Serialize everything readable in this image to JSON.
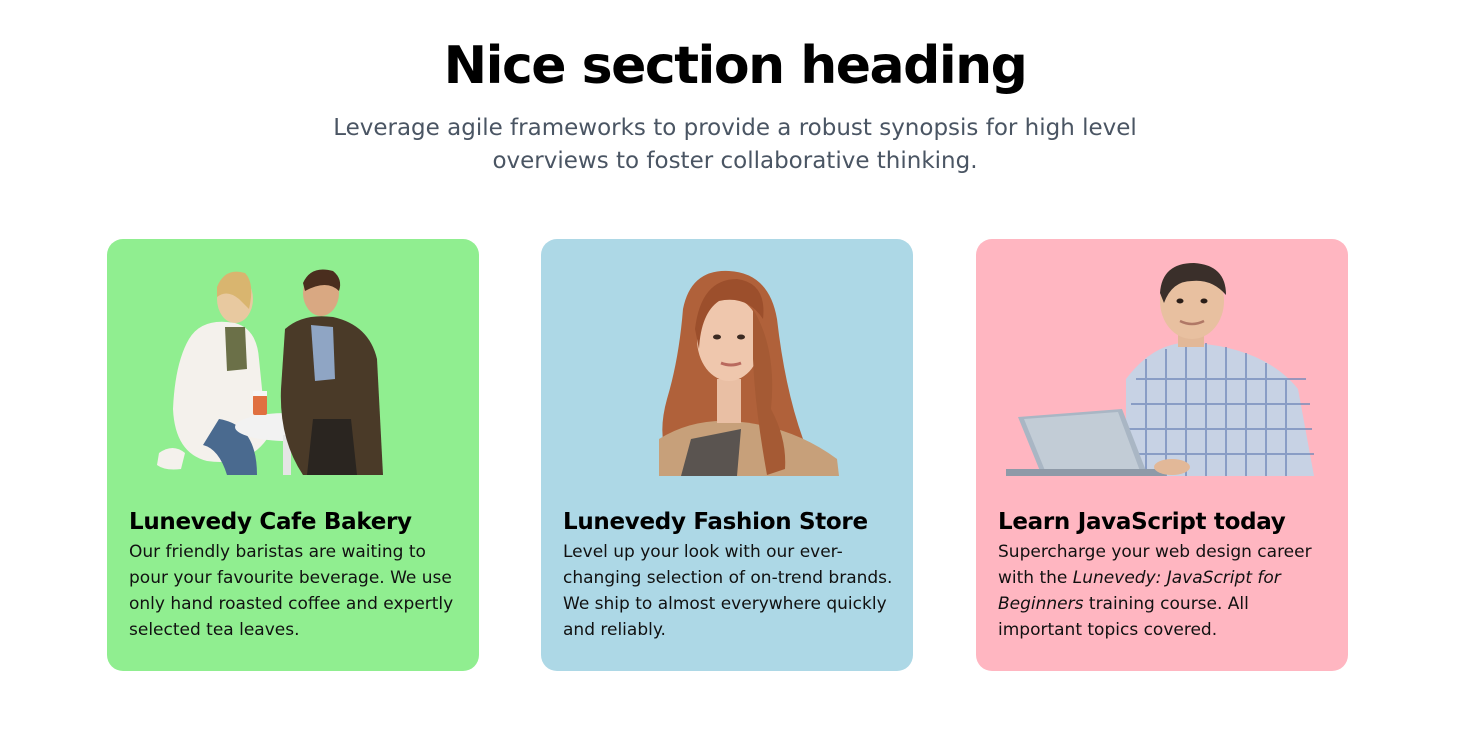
{
  "section": {
    "heading": "Nice section heading",
    "subheading": "Leverage agile frameworks to provide a robust synopsis for high level overviews to foster collaborative thinking."
  },
  "cards": [
    {
      "title": "Lunevedy Cafe Bakery",
      "text": "Our friendly baristas are waiting to pour your favourite beverage. We use only hand roasted coffee and expertly selected tea leaves.",
      "image": "couple-at-cafe-table-photo",
      "background": "#90ee90"
    },
    {
      "title": "Lunevedy Fashion Store",
      "text": "Level up your look with our ever-changing selection of on-trend brands. We ship to almost everywhere quickly and reliably.",
      "image": "woman-portrait-photo",
      "background": "#add8e6"
    },
    {
      "title": "Learn JavaScript today",
      "text_before": "Supercharge your web design career with the ",
      "text_emphasis": "Lunevedy: JavaScript for Beginners",
      "text_after": " training course. All important topics covered.",
      "image": "man-with-laptop-photo",
      "background": "#ffb6c1"
    }
  ]
}
